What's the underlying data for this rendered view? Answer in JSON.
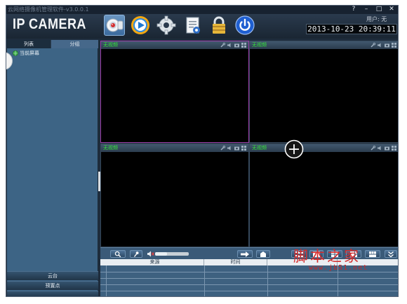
{
  "window": {
    "title": "云网络摄像机管理软件-v3.0.0.1",
    "help": "?",
    "minimize": "–",
    "maximize": "□",
    "close": "✕"
  },
  "header": {
    "brand": "IP CAMERA",
    "user_label": "用户: 无",
    "datetime": "2013-10-23  20:39:11",
    "toolbar": [
      {
        "name": "camera-view",
        "icon": "webcam-icon"
      },
      {
        "name": "playback",
        "icon": "play-icon"
      },
      {
        "name": "settings",
        "icon": "gear-icon"
      },
      {
        "name": "log",
        "icon": "document-icon"
      },
      {
        "name": "lock",
        "icon": "lock-icon"
      },
      {
        "name": "exit",
        "icon": "power-icon"
      }
    ]
  },
  "sidebar": {
    "tabs": [
      "列表",
      "分组"
    ],
    "active_tab": "列表",
    "tree": [
      {
        "label": "当前屏幕",
        "icon": "globe-icon"
      }
    ],
    "accordion": [
      "云台",
      "预置点"
    ]
  },
  "video": {
    "cells": [
      {
        "label": "无视频",
        "selected": true
      },
      {
        "label": "无视频",
        "selected": false
      },
      {
        "label": "无视频",
        "selected": false
      },
      {
        "label": "无视频",
        "selected": false
      }
    ],
    "cell_tool_icons": [
      "wrench-icon",
      "speaker-icon",
      "camera-icon",
      "grid-icon"
    ],
    "add_device_icon": "plus-circle-icon"
  },
  "controls": {
    "volume_level": 0.35,
    "buttons": [
      "search-icon",
      "mic-icon",
      "export-icon",
      "snapshot-icon",
      "layout-grid-icon",
      "layout-a-icon",
      "layout-b-icon",
      "layout-c-icon",
      "layout-d-icon",
      "expand-down-icon"
    ]
  },
  "alarm_table": {
    "columns": [
      "来源",
      "时间",
      "",
      ""
    ]
  },
  "watermark": {
    "text": "脚本之家",
    "url": "www.jb51.net"
  },
  "colors": {
    "video_label": "#35e33a",
    "selected_border": "#9b3ea8",
    "watermark": "#d42a2a"
  }
}
